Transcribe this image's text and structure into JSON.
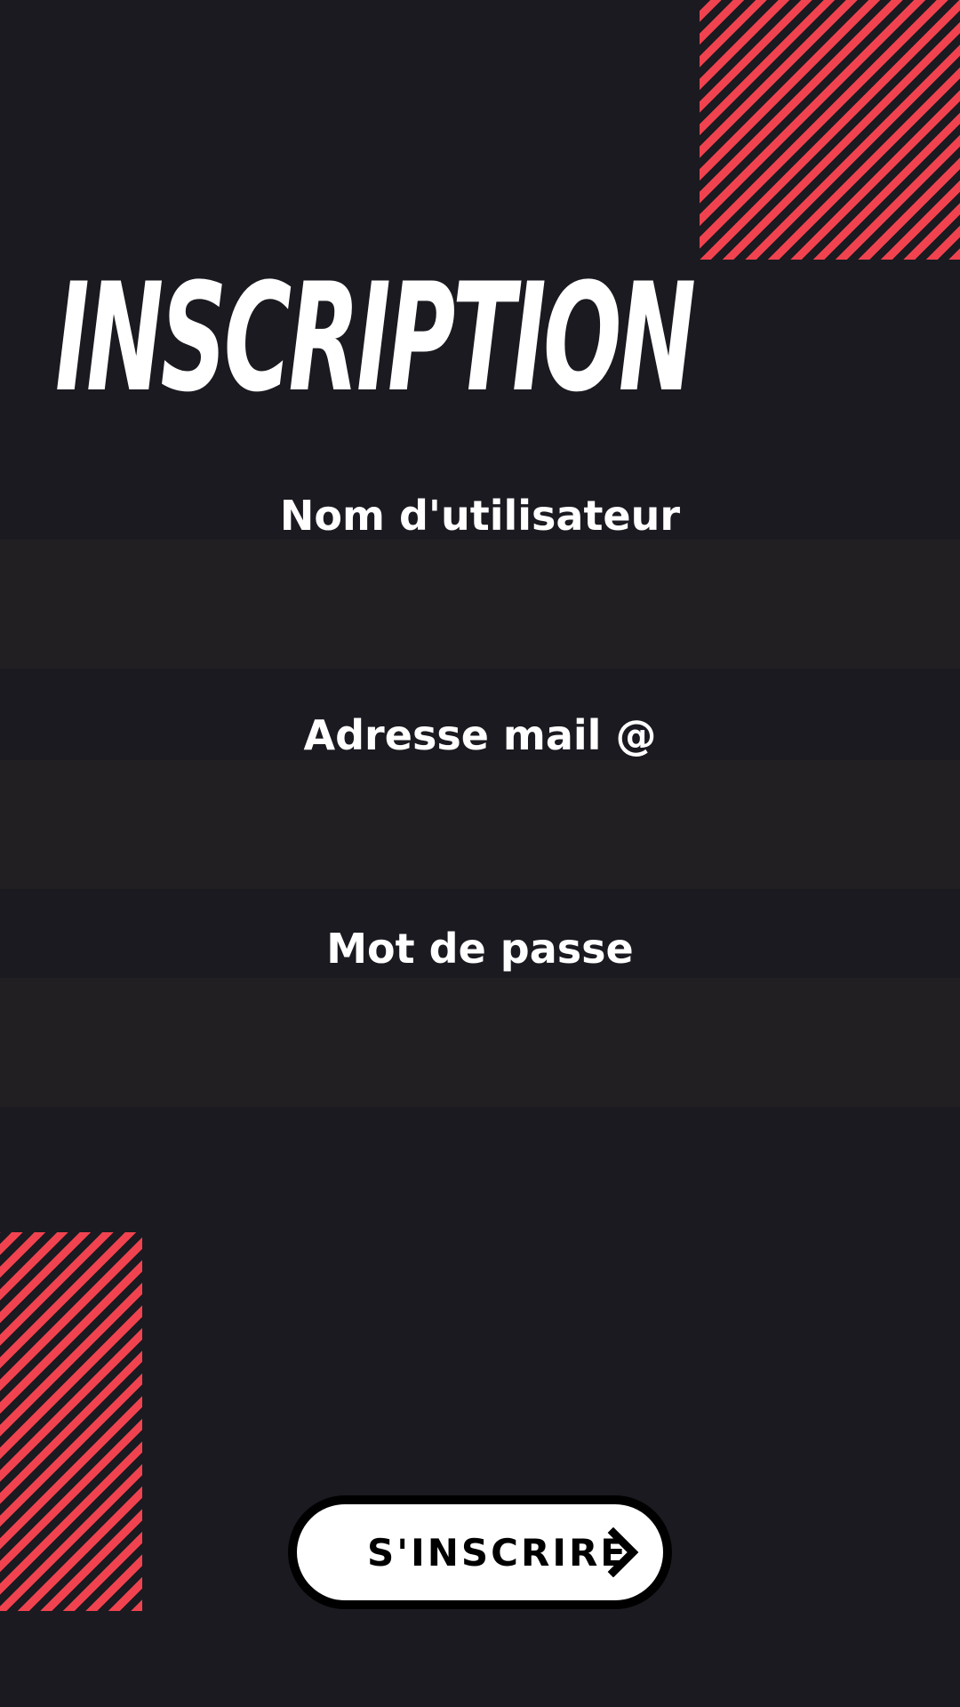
{
  "header": {
    "title": "INSCRIPTION"
  },
  "form": {
    "username": {
      "label": "Nom d'utilisateur",
      "value": ""
    },
    "email": {
      "label": "Adresse mail @",
      "value": ""
    },
    "password": {
      "label": "Mot de passe",
      "value": ""
    },
    "submit_label": "S'INSCRIRE",
    "submit_icon": "chevron-right-icon"
  },
  "colors": {
    "background": "#1b1a20",
    "accent_stripes": "#f0434f",
    "input_background": "#211f21",
    "text": "#ffffff",
    "button_background": "#ffffff",
    "button_text": "#000000"
  }
}
